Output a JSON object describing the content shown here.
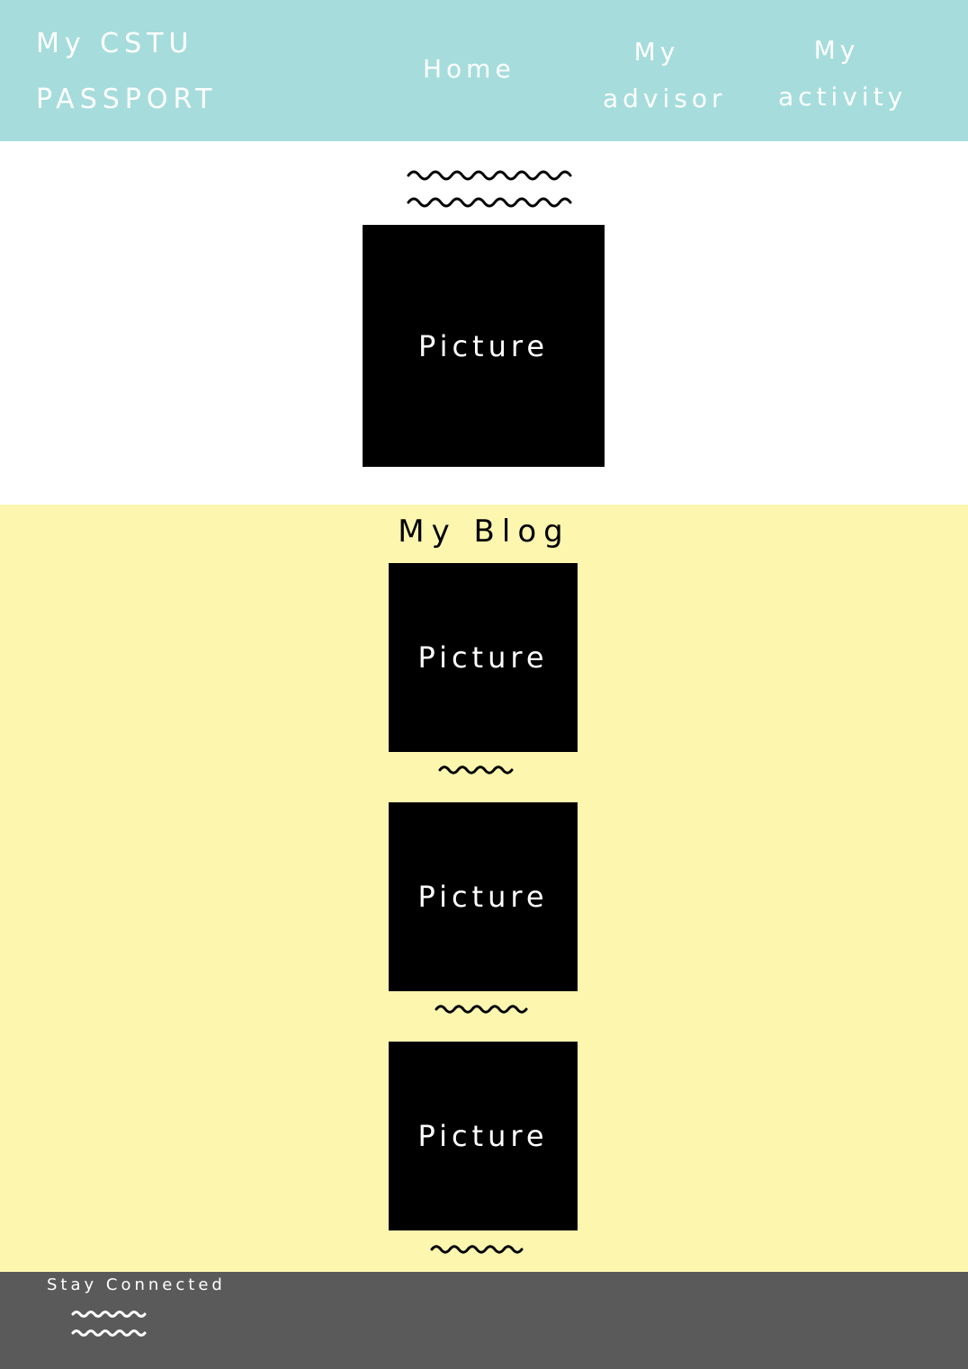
{
  "colors": {
    "header_bg": "#a6dddc",
    "blog_bg": "#fdf6af",
    "footer_bg": "#5b5a5b",
    "picture_bg": "#000000",
    "text_light": "#ffffff",
    "text_dark": "#000000"
  },
  "header": {
    "brand_line1": "My CSTU",
    "brand_line2": "PASSPORT",
    "nav": {
      "home": "Home",
      "advisor_line1": "My",
      "advisor_line2": "advisor",
      "activity_line1": "My",
      "activity_line2": "activity"
    }
  },
  "hero": {
    "picture_label": "Picture",
    "decoration": "squiggle-lines"
  },
  "blog": {
    "title": "My Blog",
    "posts": [
      {
        "picture_label": "Picture"
      },
      {
        "picture_label": "Picture"
      },
      {
        "picture_label": "Picture"
      }
    ]
  },
  "footer": {
    "title": "Stay Connected",
    "decoration": "squiggle-lines"
  }
}
